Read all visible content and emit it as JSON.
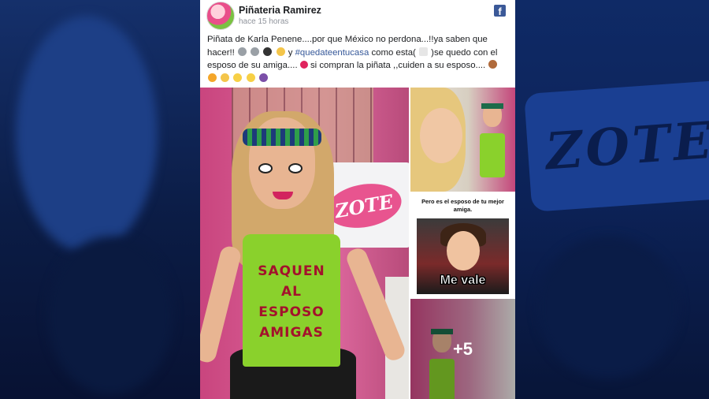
{
  "post": {
    "page_name": "Piñateria Ramirez",
    "time": "hace 15 horas",
    "text_part1": "Piñata de Karla Penene....por que México no perdona...!!ya saben que hacer!!",
    "text_part2": " y ",
    "hashtag": "#quedateentucasa",
    "text_part3": " como esta(",
    "text_part4": ")se quedo con el esposo de su amiga....",
    "text_part5": "si compran la piñata ,,cuiden a su esposo...."
  },
  "photos": {
    "main_sign": "ZOTE",
    "apron_lines": [
      "SAQUEN",
      "AL",
      "ESPOSO",
      "AMIGAS"
    ],
    "meme_caption": "Pero es el esposo de tu mejor amiga.",
    "meme_label": "Me vale",
    "more_count": "+5"
  },
  "background": {
    "sign_text": "ZOTE"
  },
  "icons": {
    "platform": "facebook-icon"
  },
  "colors": {
    "facebook_blue": "#3b5998",
    "hashtag": "#365899",
    "background": "#0c1f4d"
  }
}
